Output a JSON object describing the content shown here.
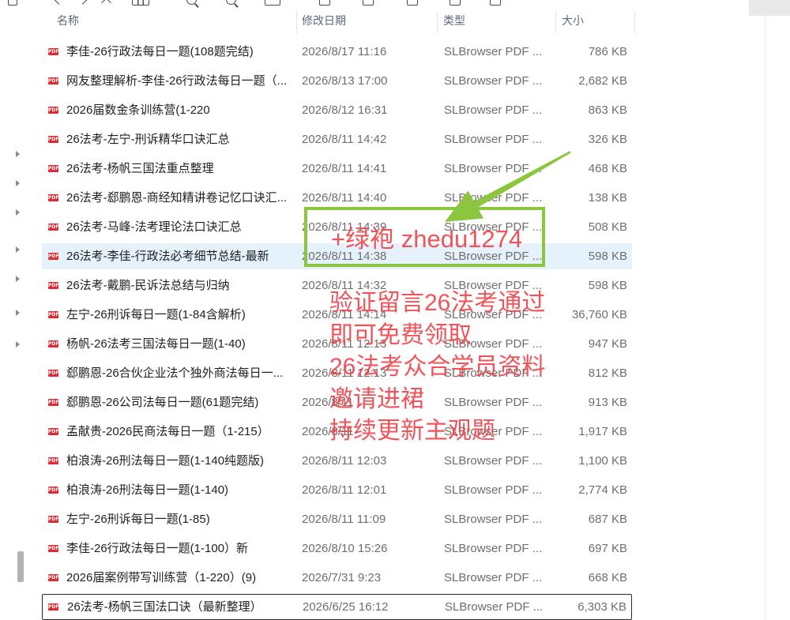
{
  "toolbar": {
    "icons": [
      "menu-icon",
      "back-icon",
      "forward-icon",
      "up-icon",
      "view-grid-icon",
      "zoom-in-icon",
      "zoom-out-icon",
      "fit-page-icon",
      "copy-icon",
      "paste-icon",
      "rename-icon",
      "share-icon",
      "delete-icon"
    ]
  },
  "navigation": {
    "expander_icon": "expand-arrow-icon"
  },
  "columns": {
    "name": "名称",
    "modified": "修改日期",
    "type": "类型",
    "size": "大小"
  },
  "file_icon": {
    "name": "pdf-file-icon",
    "label": "PDF",
    "color": "#e02a2f"
  },
  "files": [
    {
      "name": "李佳-26行政法每日一题(108题完结)",
      "modified": "2026/8/17 11:16",
      "type": "SLBrowser PDF ...",
      "size": "786 KB"
    },
    {
      "name": "网友整理解析-李佳-26行政法每日一题（...",
      "modified": "2026/8/13 17:00",
      "type": "SLBrowser PDF ...",
      "size": "2,682 KB"
    },
    {
      "name": "2026届数金条训练营(1-220",
      "modified": "2026/8/12 16:31",
      "type": "SLBrowser PDF ...",
      "size": "863 KB"
    },
    {
      "name": "26法考-左宁-刑诉精华口诀汇总",
      "modified": "2026/8/11 14:42",
      "type": "SLBrowser PDF ...",
      "size": "326 KB"
    },
    {
      "name": "26法考-杨帆三国法重点整理",
      "modified": "2026/8/11 14:41",
      "type": "SLBrowser PDF ...",
      "size": "468 KB"
    },
    {
      "name": "26法考-郄鹏恩-商经知精讲卷记忆口诀汇...",
      "modified": "2026/8/11 14:40",
      "type": "SLBrowser PDF ...",
      "size": "138 KB"
    },
    {
      "name": "26法考-马峰-法考理论法口诀汇总",
      "modified": "2026/8/11 14:39",
      "type": "SLBrowser PDF ...",
      "size": "508 KB"
    },
    {
      "name": "26法考-李佳-行政法必考细节总结-最新",
      "modified": "2026/8/11 14:38",
      "type": "SLBrowser PDF ...",
      "size": "598 KB",
      "state": "highlighted"
    },
    {
      "name": "26法考-戴鹏-民诉法总结与归纳",
      "modified": "2026/8/11 14:32",
      "type": "SLBrowser PDF ...",
      "size": "598 KB"
    },
    {
      "name": "左宁-26刑诉每日一题(1-84含解析)",
      "modified": "2026/8/11 14:14",
      "type": "SLBrowser PDF ...",
      "size": "36,760 KB"
    },
    {
      "name": "杨帆-26法考三国法每日一题(1-40)",
      "modified": "2026/8/11 12:13",
      "type": "SLBrowser PDF ...",
      "size": "947 KB"
    },
    {
      "name": "郄鹏恩-26合伙企业法个独外商法每日一...",
      "modified": "2026/8/11 12:13",
      "type": "SLBrowser PDF ...",
      "size": "812 KB"
    },
    {
      "name": "郄鹏恩-26公司法每日一题(61题完结)",
      "modified": "2026/8/11",
      "type": "SLBrowser PDF ...",
      "size": "913 KB"
    },
    {
      "name": "孟献贵-2026民商法每日一题（1-215）",
      "modified": "2026/8/11",
      "type": "SLBrowser PDF ...",
      "size": "1,917 KB"
    },
    {
      "name": "柏浪涛-26刑法每日一题(1-140纯题版)",
      "modified": "2026/8/11 12:03",
      "type": "SLBrowser PDF ...",
      "size": "1,100 KB"
    },
    {
      "name": "柏浪涛-26刑法每日一题(1-140)",
      "modified": "2026/8/11 12:01",
      "type": "SLBrowser PDF ...",
      "size": "2,774 KB"
    },
    {
      "name": "左宁-26刑诉每日一题(1-85)",
      "modified": "2026/8/11 11:09",
      "type": "SLBrowser PDF ...",
      "size": "687 KB"
    },
    {
      "name": "李佳-26行政法每日一题(1-100）新",
      "modified": "2026/8/10 15:26",
      "type": "SLBrowser PDF ...",
      "size": "697 KB"
    },
    {
      "name": "2026届案例带写训练营（1-220）(9)",
      "modified": "2026/7/31 9:23",
      "type": "SLBrowser PDF ...",
      "size": "668 KB"
    },
    {
      "name": "26法考-杨帆三国法口诀（最新整理）",
      "modified": "2026/6/25 16:12",
      "type": "SLBrowser PDF ...",
      "size": "6,303 KB",
      "state": "focused"
    }
  ],
  "overlay": {
    "contact": "+绿袍 zhedu1274",
    "lines": [
      "验证留言26法考通过",
      "即可免费领取",
      "26法考众合学员资料",
      "邀请进裙",
      "持续更新主观题"
    ],
    "arrow_icon": "green-arrow-icon"
  },
  "colors": {
    "row_highlight": "#e5f1fb",
    "focus_border": "#2b2b2b",
    "name_text": "#1f1f1f",
    "meta_text": "#6e6e6e",
    "header_text": "#5c6a7b",
    "overlay_text": "#f0464c",
    "overlay_green": "#8cc63f"
  }
}
